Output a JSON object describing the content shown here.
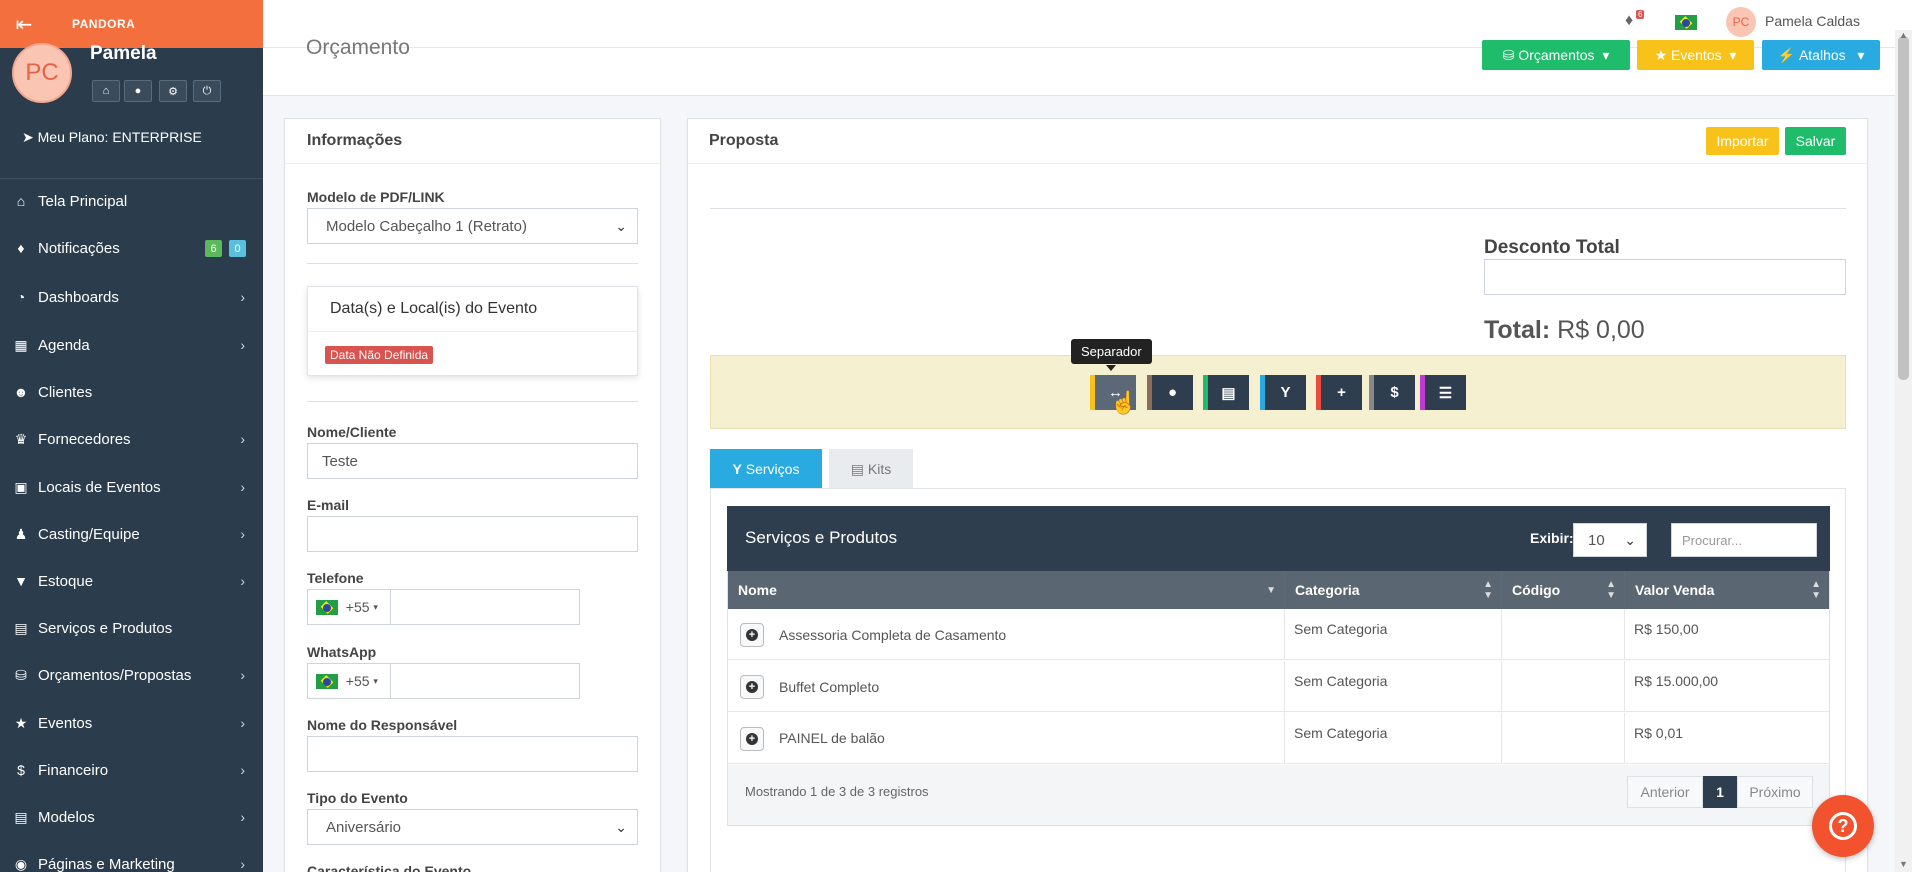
{
  "app": {
    "brand": "PANDORA",
    "avatar_initials": "PC"
  },
  "sidebar": {
    "user_name": "Pamela",
    "plan": "Meu Plano: ENTERPRISE",
    "items": [
      {
        "label": "Tela Principal",
        "icon": "home-icon"
      },
      {
        "label": "Notificações",
        "icon": "bell-icon",
        "badges": [
          "6",
          "0"
        ]
      },
      {
        "label": "Dashboards",
        "icon": "dashboard-icon"
      },
      {
        "label": "Agenda",
        "icon": "calendar-icon"
      },
      {
        "label": "Clientes",
        "icon": "users-icon"
      },
      {
        "label": "Fornecedores",
        "icon": "trophy-icon"
      },
      {
        "label": "Locais de Eventos",
        "icon": "building-icon"
      },
      {
        "label": "Casting/Equipe",
        "icon": "person-icon"
      },
      {
        "label": "Estoque",
        "icon": "glass-icon"
      },
      {
        "label": "Serviços e Produtos",
        "icon": "archive-icon"
      },
      {
        "label": "Orçamentos/Propostas",
        "icon": "cart-icon"
      },
      {
        "label": "Eventos",
        "icon": "star-icon"
      },
      {
        "label": "Financeiro",
        "icon": "dollar-icon"
      },
      {
        "label": "Modelos",
        "icon": "file-icon"
      },
      {
        "label": "Páginas e Marketing",
        "icon": "globe-icon"
      }
    ]
  },
  "topbar": {
    "notif_count": "6",
    "user_name": "Pamela Caldas"
  },
  "header": {
    "title": "Orçamento",
    "btn_orcamentos": "Orçamentos",
    "btn_eventos": "Eventos",
    "btn_atalhos": "Atalhos"
  },
  "info": {
    "title": "Informações",
    "pdf_label": "Modelo de PDF/LINK",
    "pdf_value": "Modelo Cabeçalho 1 (Retrato)",
    "event_card_title": "Data(s) e Local(is) do Evento",
    "event_date_badge": "Data Não Definida",
    "name_label": "Nome/Cliente",
    "name_value": "Teste",
    "email_label": "E-mail",
    "email_value": "",
    "phone_label": "Telefone",
    "phone_code": "+55",
    "whatsapp_label": "WhatsApp",
    "whatsapp_code": "+55",
    "resp_label": "Nome do Responsável",
    "resp_value": "",
    "type_label": "Tipo do Evento",
    "type_value": "Aniversário",
    "char_label": "Característica do Evento"
  },
  "proposal": {
    "title": "Proposta",
    "btn_import": "Importar",
    "btn_save": "Salvar",
    "discount_label": "Desconto Total",
    "discount_value": "",
    "total_label": "Total:",
    "total_value": "R$ 0,00",
    "tooltip": "Separador",
    "tabs": [
      "Serviços",
      "Kits"
    ]
  },
  "table": {
    "title": "Serviços e Produtos",
    "show_label": "Exibir:",
    "show_value": "10",
    "search_placeholder": "Procurar...",
    "columns": [
      "Nome",
      "Categoria",
      "Código",
      "Valor Venda"
    ],
    "rows": [
      {
        "name": "Assessoria Completa de Casamento",
        "category": "Sem Categoria",
        "code": "",
        "price": "R$ 150,00"
      },
      {
        "name": "Buffet Completo",
        "category": "Sem Categoria",
        "code": "",
        "price": "R$ 15.000,00"
      },
      {
        "name": "PAINEL de balão",
        "category": "Sem Categoria",
        "code": "",
        "price": "R$ 0,01"
      }
    ],
    "footer": "Mostrando 1 de 3 de 3 registros",
    "prev": "Anterior",
    "page": "1",
    "next": "Próximo"
  },
  "colors": {
    "brand": "#f36f3d",
    "sidebar": "#2b3c4d",
    "green": "#1fbc6b",
    "yellow": "#f8c21a",
    "cyan": "#29abe2"
  }
}
